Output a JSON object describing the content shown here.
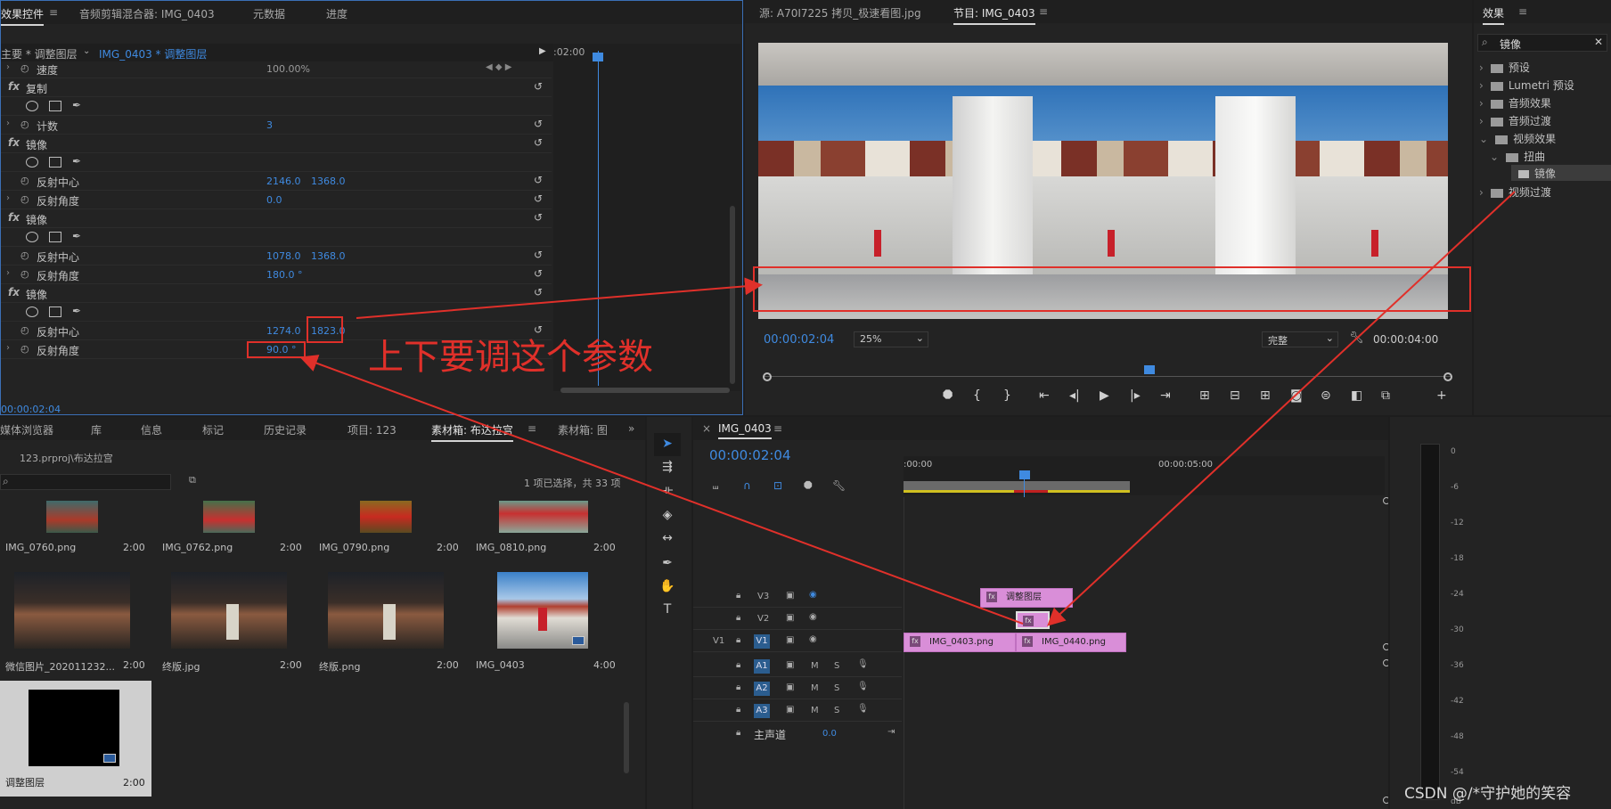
{
  "effect_controls": {
    "tabs": [
      "效果控件",
      "音频剪辑混合器: IMG_0403",
      "元数据",
      "进度"
    ],
    "header_left": "主要 * 调整图层",
    "header_right": "IMG_0403 * 调整图层",
    "timecode_mini": ":02:00",
    "rows": {
      "speed_label": "速度",
      "speed_value": "100.00%",
      "copy_label": "复制",
      "count_label": "计数",
      "count_value": "3",
      "mirror1_label": "镜像",
      "center1_label": "反射中心",
      "center1_x": "2146.0",
      "center1_y": "1368.0",
      "angle1_label": "反射角度",
      "angle1_value": "0.0",
      "mirror2_label": "镜像",
      "center2_label": "反射中心",
      "center2_x": "1078.0",
      "center2_y": "1368.0",
      "angle2_label": "反射角度",
      "angle2_value": "180.0 °",
      "mirror3_label": "镜像",
      "center3_label": "反射中心",
      "center3_x": "1274.0",
      "center3_y": "1823.0",
      "angle3_label": "反射角度",
      "angle3_value": "90.0 °"
    },
    "footer_timecode": "00:00:02:04"
  },
  "annotation": {
    "text": "上下要调这个参数",
    "color": "#e0302a"
  },
  "source_tab": "源: A70I7225 拷贝_极速看图.jpg",
  "program": {
    "tab": "节目: IMG_0403",
    "timecode": "00:00:02:04",
    "zoom": "25%",
    "quality": "完整",
    "duration": "00:00:04:00"
  },
  "effects_panel": {
    "title": "效果",
    "search_value": "镜像",
    "items": [
      "预设",
      "Lumetri 预设",
      "音频效果",
      "音频过渡",
      "视频效果",
      "扭曲",
      "镜像",
      "视频过渡"
    ]
  },
  "project": {
    "tabs": [
      "媒体浏览器",
      "库",
      "信息",
      "标记",
      "历史记录",
      "项目: 123",
      "素材箱: 布达拉宫",
      "素材箱: 图"
    ],
    "path": "123.prproj\\布达拉宫",
    "selection_info": "1 项已选择，共 33 项",
    "items": [
      {
        "name": "IMG_0760.png",
        "dur": "2:00"
      },
      {
        "name": "IMG_0762.png",
        "dur": "2:00"
      },
      {
        "name": "IMG_0790.png",
        "dur": "2:00"
      },
      {
        "name": "IMG_0810.png",
        "dur": "2:00"
      },
      {
        "name": "微信图片_202011232...",
        "dur": "2:00"
      },
      {
        "name": "终版.jpg",
        "dur": "2:00"
      },
      {
        "name": "终版.png",
        "dur": "2:00"
      },
      {
        "name": "IMG_0403",
        "dur": "4:00"
      },
      {
        "name": "调整图层",
        "dur": "2:00"
      }
    ]
  },
  "timeline": {
    "tab": "IMG_0403",
    "timecode": "00:00:02:04",
    "ruler": [
      ":00:00",
      "00:00:05:00"
    ],
    "tracks": {
      "v3": "V3",
      "v2": "V2",
      "v1": "V1",
      "src_v1": "V1",
      "a1": "A1",
      "a2": "A2",
      "a3": "A3",
      "master": "主声道",
      "master_value": "0.0"
    },
    "clips": {
      "adjust": "调整图层",
      "img0403": "IMG_0403.png",
      "img0440": "IMG_0440.png",
      "fx": "fx"
    }
  },
  "meter": {
    "ticks": [
      "0",
      "-6",
      "-12",
      "-18",
      "-24",
      "-30",
      "-36",
      "-42",
      "-48",
      "-54",
      "dB"
    ]
  },
  "watermark": "CSDN @/*守护她的笑容"
}
